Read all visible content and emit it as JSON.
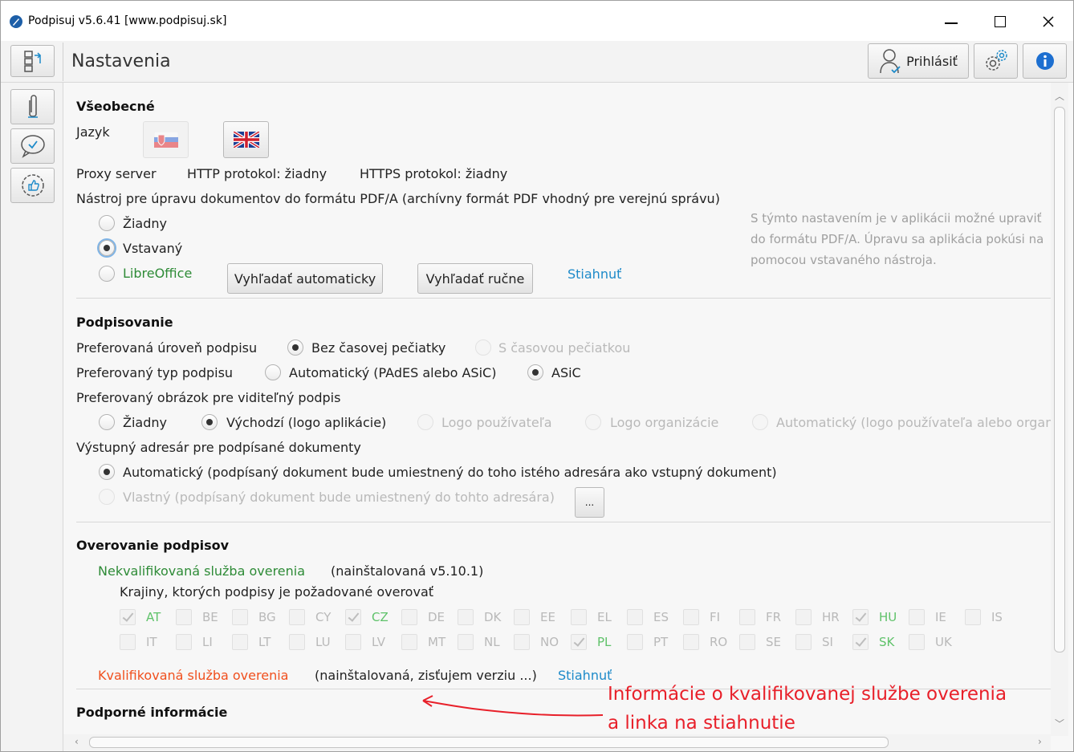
{
  "window": {
    "title": "Podpisuj v5.6.41 [www.podpisuj.sk]",
    "controls": {
      "minimize": "—",
      "maximize": "☐",
      "close": "✕"
    }
  },
  "header": {
    "page_title": "Nastavenia",
    "login_label": "Prihlásiť"
  },
  "general": {
    "title": "Všeobecné",
    "language_label": "Jazyk",
    "proxy_label": "Proxy server",
    "http_label": "HTTP protokol: žiadny",
    "https_label": "HTTPS protokol: žiadny",
    "pdfa_label": "Nástroj pre úpravu dokumentov do formátu PDF/A (archívny formát PDF vhodný pre verejnú správu)",
    "pdfa_options": [
      "Žiadny",
      "Vstavaný",
      "LibreOffice"
    ],
    "pdfa_selected": "Vstavaný",
    "btn_auto": "Vyhľadať automaticky",
    "btn_manual": "Vyhľadať ručne",
    "download_link": "Stiahnuť",
    "hint_lines": [
      "S týmto nastavením je v aplikácii možné upraviť",
      "do formátu PDF/A. Úpravu sa aplikácia pokúsi na",
      "pomocou vstavaného nástroja."
    ]
  },
  "signing": {
    "title": "Podpisovanie",
    "level_label": "Preferovaná úroveň podpisu",
    "level_options": [
      "Bez časovej pečiatky",
      "S časovou pečiatkou"
    ],
    "type_label": "Preferovaný typ podpisu",
    "type_options": [
      "Automatický (PAdES alebo ASiC)",
      "ASiC"
    ],
    "image_label": "Preferovaný obrázok pre viditeľný podpis",
    "image_options": [
      "Žiadny",
      "Východzí (logo aplikácie)",
      "Logo používateľa",
      "Logo organizácie",
      "Automatický (logo používateľa alebo organi"
    ],
    "output_label": "Výstupný adresár pre podpísané dokumenty",
    "output_auto": "Automatický (podpísaný dokument bude umiestnený do toho istého adresára ako vstupný dokument)",
    "output_custom": "Vlastný (podpísaný dokument bude umiestnený do tohto adresára)",
    "browse_label": "..."
  },
  "verification": {
    "title": "Overovanie podpisov",
    "unqualified_label": "Nekvalifikovaná služba overenia",
    "unqualified_status": "(nainštalovaná v5.10.1)",
    "countries_label": "Krajiny, ktorých podpisy je požadované overovať",
    "countries_row1": [
      {
        "code": "AT",
        "checked": true
      },
      {
        "code": "BE",
        "checked": false
      },
      {
        "code": "BG",
        "checked": false
      },
      {
        "code": "CY",
        "checked": false
      },
      {
        "code": "CZ",
        "checked": true
      },
      {
        "code": "DE",
        "checked": false
      },
      {
        "code": "DK",
        "checked": false
      },
      {
        "code": "EE",
        "checked": false
      },
      {
        "code": "EL",
        "checked": false
      },
      {
        "code": "ES",
        "checked": false
      },
      {
        "code": "FI",
        "checked": false
      },
      {
        "code": "FR",
        "checked": false
      },
      {
        "code": "HR",
        "checked": false
      },
      {
        "code": "HU",
        "checked": true
      },
      {
        "code": "IE",
        "checked": false
      },
      {
        "code": "IS",
        "checked": false
      }
    ],
    "countries_row2": [
      {
        "code": "IT",
        "checked": false
      },
      {
        "code": "LI",
        "checked": false
      },
      {
        "code": "LT",
        "checked": false
      },
      {
        "code": "LU",
        "checked": false
      },
      {
        "code": "LV",
        "checked": false
      },
      {
        "code": "MT",
        "checked": false
      },
      {
        "code": "NL",
        "checked": false
      },
      {
        "code": "NO",
        "checked": false
      },
      {
        "code": "PL",
        "checked": true
      },
      {
        "code": "PT",
        "checked": false
      },
      {
        "code": "RO",
        "checked": false
      },
      {
        "code": "SE",
        "checked": false
      },
      {
        "code": "SI",
        "checked": false
      },
      {
        "code": "SK",
        "checked": true
      },
      {
        "code": "UK",
        "checked": false
      }
    ],
    "qualified_label": "Kvalifikovaná služba overenia",
    "qualified_status": "(nainštalovaná, zisťujem verziu ...)",
    "download_link": "Stiahnuť"
  },
  "support": {
    "title": "Podporné informácie"
  },
  "annotation": {
    "line1": "Informácie o kvalifikovanej službe overenia",
    "line2": "a linka na stiahnutie"
  },
  "colors": {
    "accent_link": "#1d8ac9",
    "green_status": "#2e8b37",
    "orange_status": "#f0501e",
    "annotation_red": "#e8202a"
  }
}
